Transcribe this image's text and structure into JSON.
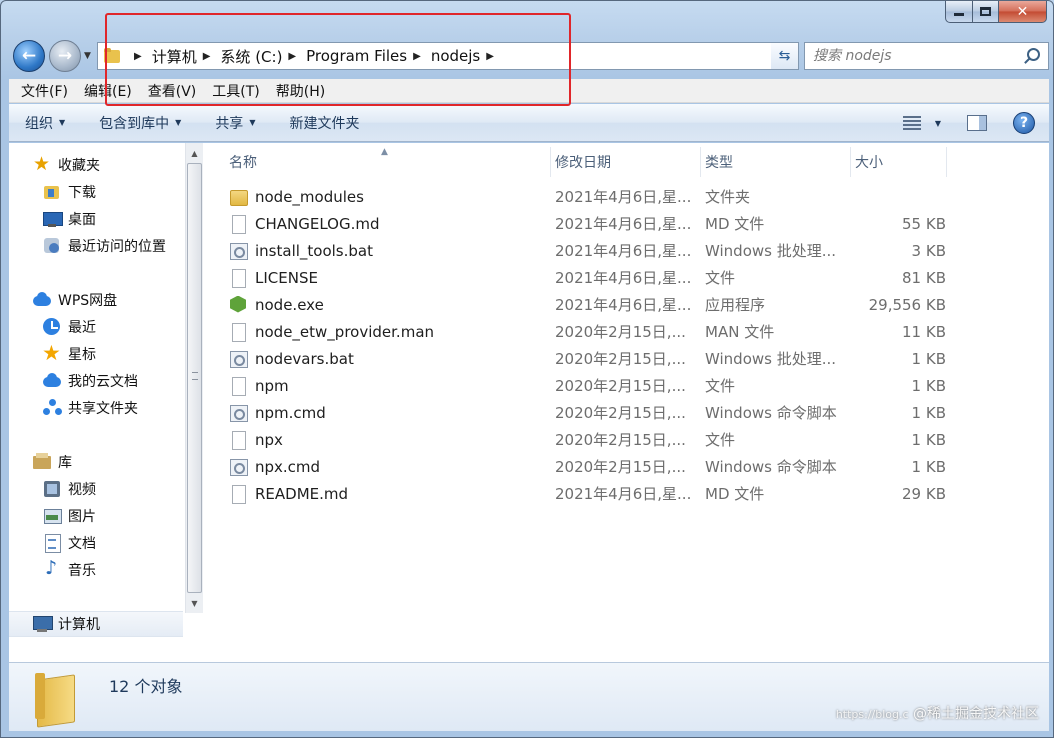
{
  "addressbar": {
    "crumbs": [
      "计算机",
      "系统 (C:)",
      "Program Files",
      "nodejs"
    ]
  },
  "search": {
    "placeholder": "搜索 nodejs"
  },
  "menubar": {
    "items": [
      "文件(F)",
      "编辑(E)",
      "查看(V)",
      "工具(T)",
      "帮助(H)"
    ]
  },
  "commandbar": {
    "organize": "组织",
    "include_library": "包含到库中",
    "share": "共享",
    "new_folder": "新建文件夹"
  },
  "sidebar": {
    "favorites": "收藏夹",
    "downloads": "下载",
    "desktop": "桌面",
    "recent_places": "最近访问的位置",
    "wps": "WPS网盘",
    "recent": "最近",
    "starred": "星标",
    "my_cloud": "我的云文档",
    "shared_folder": "共享文件夹",
    "libraries": "库",
    "videos": "视频",
    "pictures": "图片",
    "documents": "文档",
    "music": "音乐",
    "computer": "计算机"
  },
  "columns": {
    "name": "名称",
    "date": "修改日期",
    "type": "类型",
    "size": "大小"
  },
  "files": [
    {
      "name": "node_modules",
      "date": "2021年4月6日,星...",
      "type": "文件夹",
      "size": "",
      "icon": "folder-icon"
    },
    {
      "name": "CHANGELOG.md",
      "date": "2021年4月6日,星...",
      "type": "MD 文件",
      "size": "55 KB",
      "icon": "file-icon"
    },
    {
      "name": "install_tools.bat",
      "date": "2021年4月6日,星...",
      "type": "Windows 批处理...",
      "size": "3 KB",
      "icon": "batch-file-icon"
    },
    {
      "name": "LICENSE",
      "date": "2021年4月6日,星...",
      "type": "文件",
      "size": "81 KB",
      "icon": "file-icon"
    },
    {
      "name": "node.exe",
      "date": "2021年4月6日,星...",
      "type": "应用程序",
      "size": "29,556 KB",
      "icon": "nodejs-exe-icon"
    },
    {
      "name": "node_etw_provider.man",
      "date": "2020年2月15日,...",
      "type": "MAN 文件",
      "size": "11 KB",
      "icon": "file-icon"
    },
    {
      "name": "nodevars.bat",
      "date": "2020年2月15日,...",
      "type": "Windows 批处理...",
      "size": "1 KB",
      "icon": "batch-file-icon"
    },
    {
      "name": "npm",
      "date": "2020年2月15日,...",
      "type": "文件",
      "size": "1 KB",
      "icon": "file-icon"
    },
    {
      "name": "npm.cmd",
      "date": "2020年2月15日,...",
      "type": "Windows 命令脚本",
      "size": "1 KB",
      "icon": "batch-file-icon"
    },
    {
      "name": "npx",
      "date": "2020年2月15日,...",
      "type": "文件",
      "size": "1 KB",
      "icon": "file-icon"
    },
    {
      "name": "npx.cmd",
      "date": "2020年2月15日,...",
      "type": "Windows 命令脚本",
      "size": "1 KB",
      "icon": "batch-file-icon"
    },
    {
      "name": "README.md",
      "date": "2021年4月6日,星...",
      "type": "MD 文件",
      "size": "29 KB",
      "icon": "file-icon"
    }
  ],
  "details": {
    "count": "12 个对象"
  },
  "watermark": {
    "url": "https://blog.c",
    "text": "@稀土掘金技术社区"
  },
  "colors": {
    "highlight_box": "#e0262a",
    "accent": "#1e395b"
  }
}
